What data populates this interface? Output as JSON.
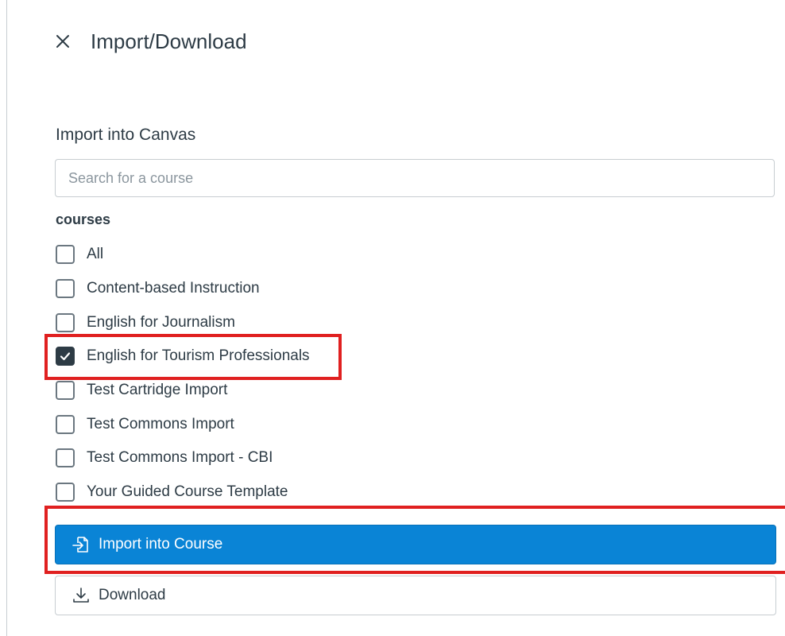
{
  "header": {
    "title": "Import/Download",
    "close_icon": "close-icon"
  },
  "import_section": {
    "title": "Import into Canvas",
    "search": {
      "placeholder": "Search for a course",
      "value": ""
    },
    "group_label": "courses",
    "courses": [
      {
        "label": "All",
        "checked": false
      },
      {
        "label": "Content-based Instruction",
        "checked": false
      },
      {
        "label": "English for Journalism",
        "checked": false
      },
      {
        "label": "English for Tourism Professionals",
        "checked": true
      },
      {
        "label": "Test Cartridge Import",
        "checked": false
      },
      {
        "label": "Test Commons Import",
        "checked": false
      },
      {
        "label": "Test Commons Import - CBI",
        "checked": false
      },
      {
        "label": "Your Guided Course Template",
        "checked": false
      }
    ]
  },
  "actions": {
    "import_label": "Import into Course",
    "import_icon": "import-icon",
    "download_label": "Download",
    "download_icon": "download-icon"
  },
  "colors": {
    "primary": "#0a84d6",
    "text": "#2d3b45",
    "highlight": "#e02020",
    "border": "#c7cdd1"
  }
}
